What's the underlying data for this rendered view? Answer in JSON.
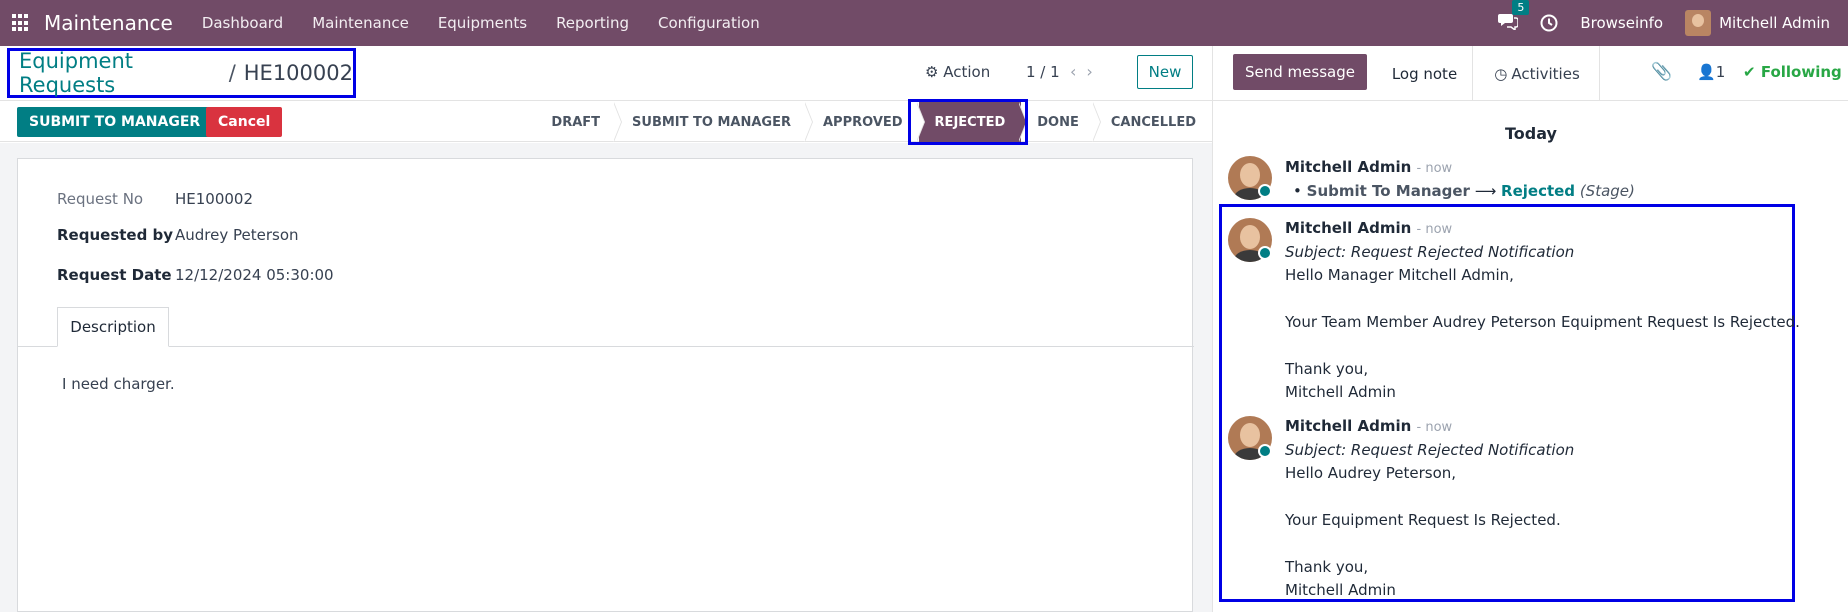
{
  "navbar": {
    "app_title": "Maintenance",
    "menu": [
      "Dashboard",
      "Maintenance",
      "Equipments",
      "Reporting",
      "Configuration"
    ],
    "chat_count": "5",
    "company": "Browseinfo",
    "user": "Mitchell Admin",
    "accent": "#714b67"
  },
  "breadcrumb": {
    "parent": "Equipment Requests",
    "separator": "/",
    "current": "HE100002"
  },
  "controls": {
    "action_label": "Action",
    "pager": "1 / 1",
    "new_label": "New"
  },
  "buttons": {
    "submit": "SUBMIT TO MANAGER",
    "cancel": "Cancel"
  },
  "stages": [
    "DRAFT",
    "SUBMIT TO MANAGER",
    "APPROVED",
    "REJECTED",
    "DONE",
    "CANCELLED"
  ],
  "active_stage": "REJECTED",
  "form": {
    "request_no_label": "Request No",
    "request_no": "HE100002",
    "requested_by_label": "Requested by",
    "requested_by": "Audrey Peterson",
    "request_date_label": "Request Date",
    "request_date": "12/12/2024 05:30:00",
    "tab_label": "Description",
    "description": "I need charger."
  },
  "chatter": {
    "send_message": "Send message",
    "log_note": "Log note",
    "activities": "Activities",
    "followers_count": "1",
    "following": "Following",
    "day_label": "Today",
    "tracking": {
      "author": "Mitchell Admin",
      "time": "- now",
      "old_value": "Submit To Manager",
      "new_value": "Rejected",
      "field": "(Stage)"
    },
    "messages": [
      {
        "author": "Mitchell Admin",
        "time": "- now",
        "subject": "Subject: Request Rejected Notification",
        "greeting": "Hello Manager Mitchell Admin,",
        "body": "Your Team Member Audrey Peterson Equipment Request Is Rejected.",
        "closing": "Thank you,",
        "signature": "Mitchell Admin"
      },
      {
        "author": "Mitchell Admin",
        "time": "- now",
        "subject": "Subject: Request Rejected Notification",
        "greeting": "Hello Audrey Peterson,",
        "body": "Your Equipment Request Is Rejected.",
        "closing": "Thank you,",
        "signature": "Mitchell Admin"
      }
    ]
  }
}
